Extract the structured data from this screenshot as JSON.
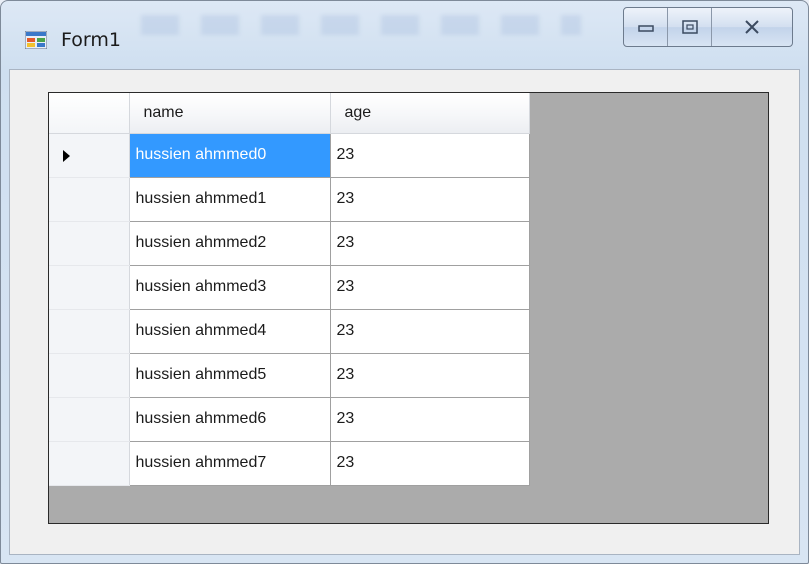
{
  "window": {
    "title": "Form1"
  },
  "grid": {
    "columns": [
      "name",
      "age"
    ],
    "rows": [
      {
        "name": "hussien ahmmed0",
        "age": "23"
      },
      {
        "name": "hussien ahmmed1",
        "age": "23"
      },
      {
        "name": "hussien ahmmed2",
        "age": "23"
      },
      {
        "name": "hussien ahmmed3",
        "age": "23"
      },
      {
        "name": "hussien ahmmed4",
        "age": "23"
      },
      {
        "name": "hussien ahmmed5",
        "age": "23"
      },
      {
        "name": "hussien ahmmed6",
        "age": "23"
      },
      {
        "name": "hussien ahmmed7",
        "age": "23"
      }
    ],
    "selected_row": 0,
    "selection_color": "#3399ff",
    "background_color": "#ababab"
  },
  "icons": {
    "app": "form-app-icon",
    "minimize": "minimize-icon",
    "maximize": "maximize-icon",
    "close": "close-icon",
    "current_row": "current-row-arrow-icon"
  }
}
